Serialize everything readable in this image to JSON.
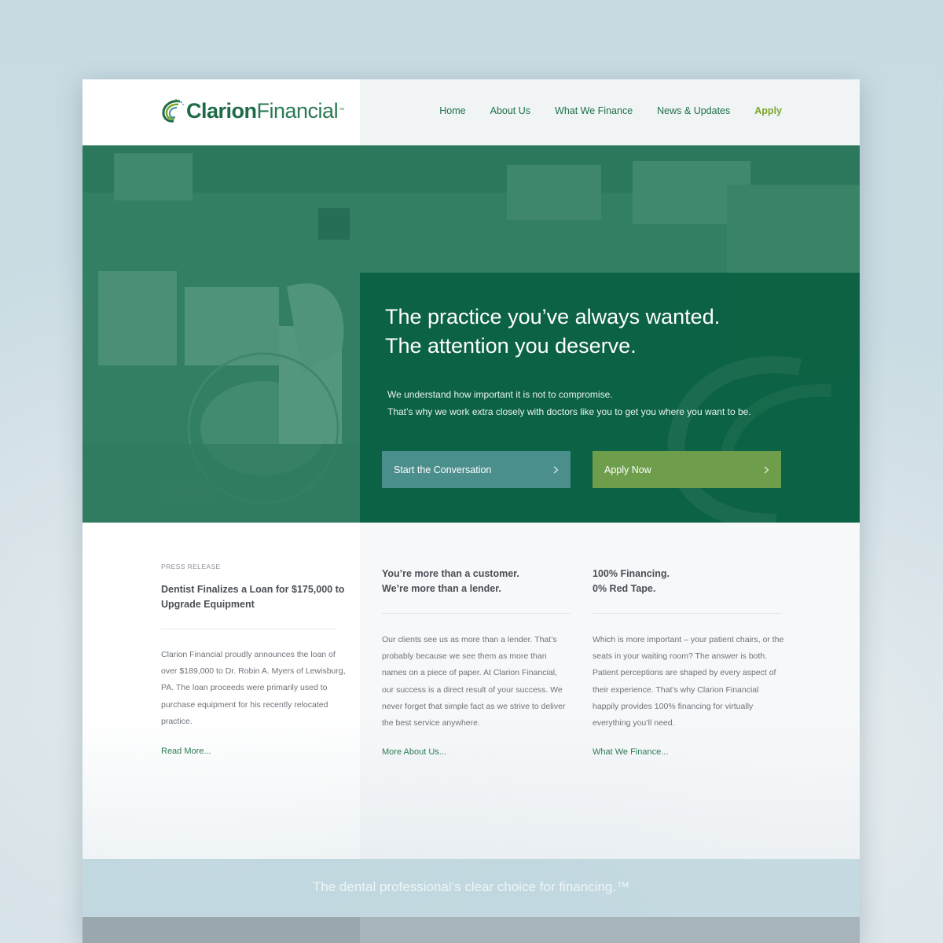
{
  "brand": {
    "name_bold": "Clarion",
    "name_regular": "Financial",
    "tm": "™",
    "colors": {
      "primary_green": "#0a6042",
      "accent_green": "#7aa62b",
      "teal_button": "#4b8f8c",
      "apply_button": "#6e9e4b"
    }
  },
  "nav": {
    "items": [
      {
        "label": "Home"
      },
      {
        "label": "About Us"
      },
      {
        "label": "What We Finance"
      },
      {
        "label": "News & Updates"
      },
      {
        "label": "Apply"
      }
    ]
  },
  "hero": {
    "title_line1": "The practice you’ve always wanted.",
    "title_line2": "The attention you deserve.",
    "sub_line1": "We understand how important it is not to compromise.",
    "sub_line2": "That’s why we work extra closely with doctors like you to get you where you want to be.",
    "button_conversation": "Start the Conversation",
    "button_apply": "Apply Now"
  },
  "press": {
    "eyebrow": "PRESS RELEASE",
    "title_line1": "Dentist Finalizes a Loan for $175,000 to",
    "title_line2": "Upgrade Equipment",
    "body": [
      "Clarion Financial proudly announces the loan of",
      "over $189,000 to Dr. Robin A. Myers of Lewisburg,",
      "PA. The loan proceeds were primarily used to",
      "purchase equipment for his recently relocated",
      "practice."
    ],
    "link": "Read More..."
  },
  "about": {
    "title_line1": "You’re more than a customer.",
    "title_line2": "We’re  more than a lender.",
    "body": [
      "Our clients see us as more than a lender. That’s",
      "probably because we see them as more than",
      "names on a piece of paper. At Clarion Financial,",
      "our success is a direct result of your success. We",
      "never forget that simple fact as we strive to deliver",
      "the best service anywhere."
    ],
    "link": "More About Us..."
  },
  "finance": {
    "title_line1": "100% Financing.",
    "title_line2": "0% Red Tape.",
    "body": [
      "Which is more important – your patient chairs, or the",
      "seats in your waiting room? The answer is both.",
      "Patient perceptions are shaped by every aspect of",
      "their experience. That’s why Clarion Financial",
      "happily provides 100% financing for virtually",
      "everything you’ll need."
    ],
    "link": "What We Finance..."
  },
  "tagline": "The dental professional’s clear choice for financing.™",
  "icons": {
    "button_chevron": "chevron-right-icon",
    "logo": "clarion-swoosh-logo"
  }
}
